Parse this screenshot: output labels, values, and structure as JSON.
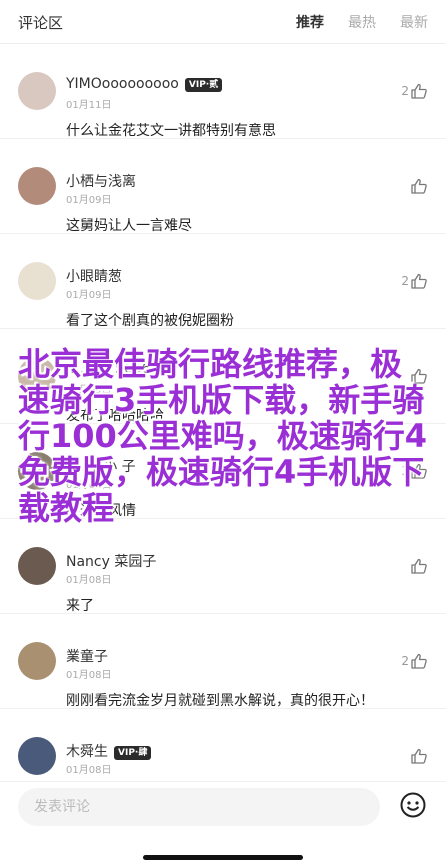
{
  "header": {
    "title": "评论区",
    "tabs": [
      {
        "label": "推荐",
        "active": true
      },
      {
        "label": "最热",
        "active": false
      },
      {
        "label": "最新",
        "active": false
      }
    ]
  },
  "comments": [
    {
      "user": "YIMOooooooooo",
      "vip": "VIP·贰",
      "date": "01月11日",
      "text": "什么让金花艾文一讲都特别有意思",
      "likes": "2",
      "avatar_color": "#d8c8c0"
    },
    {
      "user": "小栖与浅离",
      "vip": "",
      "date": "01月09日",
      "text": "这舅妈让人一言难尽",
      "likes": "",
      "avatar_color": "#b38b7a"
    },
    {
      "user": "小眼睛葱",
      "vip": "",
      "date": "01月09日",
      "text": "看了这个剧真的被倪妮圈粉",
      "likes": "2",
      "avatar_color": "#e8e0d0"
    },
    {
      "user": "J…e…i 5666",
      "vip": "",
      "date": "01月09日",
      "text": "发布了哈哈哈哈",
      "likes": "",
      "avatar_color": "#c9b8a8"
    },
    {
      "user": "N…y 小 子",
      "vip": "",
      "date": "01月08日",
      "text": "不过…风情",
      "likes": "3",
      "avatar_color": "#8a7d70"
    },
    {
      "user": "Nancy 菜园子",
      "vip": "",
      "date": "01月08日",
      "text": "来了",
      "likes": "",
      "avatar_color": "#6b5a50"
    },
    {
      "user": "業童子",
      "vip": "",
      "date": "01月08日",
      "text": "刚刚看完流金岁月就碰到黑水解说，真的很开心！",
      "likes": "2",
      "avatar_color": "#a89070"
    },
    {
      "user": "木舜生",
      "vip": "VIP·肆",
      "date": "01月08日",
      "text": "",
      "likes": "",
      "avatar_color": "#4a5a7a"
    }
  ],
  "overlay_text": "北京最佳骑行路线推荐，极速骑行3手机版下载，新手骑行100公里难吗，极速骑行4免费版，极速骑行4手机版下载教程",
  "input": {
    "placeholder": "发表评论"
  },
  "colors": {
    "overlay": "#9b2fd6",
    "vip_badge": "#2b2b2b"
  }
}
